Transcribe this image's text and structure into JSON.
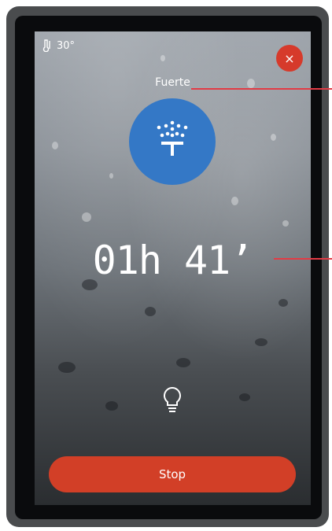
{
  "status": {
    "temperature": "30°",
    "temperature_icon": "thermometer-icon"
  },
  "close_button": {
    "label": "×"
  },
  "shower": {
    "mode_label": "Fuerte",
    "mode_icon": "rain-shower-icon"
  },
  "timer": {
    "display": "01h 41’"
  },
  "light": {
    "icon": "lightbulb-icon"
  },
  "stop_button": {
    "label": "Stop"
  },
  "colors": {
    "accent_red": "#d23f27",
    "mode_blue": "#3478c6",
    "callout_red": "#e23b45"
  }
}
